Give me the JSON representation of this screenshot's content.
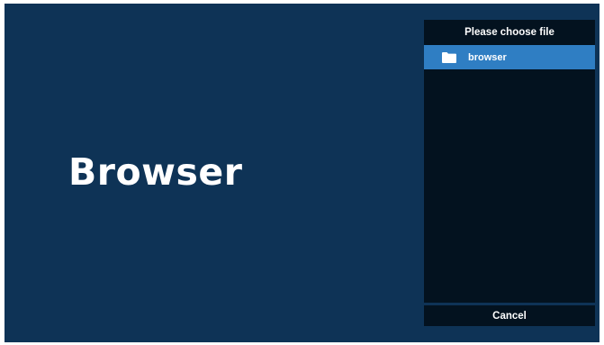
{
  "app": {
    "title": "Browser"
  },
  "file_dialog": {
    "header": "Please choose file",
    "items": [
      {
        "label": "browser",
        "icon": "folder-icon",
        "selected": true
      }
    ],
    "cancel_label": "Cancel"
  },
  "colors": {
    "background": "#0e3356",
    "panel": "#03121f",
    "selection": "#2f7ec3",
    "text": "#ffffff"
  }
}
